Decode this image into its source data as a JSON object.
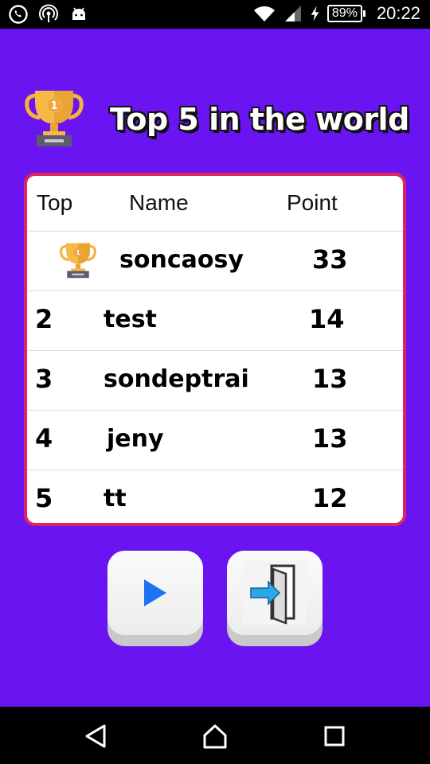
{
  "status_bar": {
    "battery": "89%",
    "time": "20:22",
    "icons": [
      "whatsapp-icon",
      "hotspot-icon",
      "android-icon",
      "wifi-icon",
      "signal-icon",
      "charging-icon"
    ]
  },
  "header": {
    "title": "Top 5 in the world",
    "trophy_icon": "trophy-icon"
  },
  "leaderboard": {
    "columns": {
      "rank": "Top",
      "name": "Name",
      "point": "Point"
    },
    "rows": [
      {
        "rank": "",
        "rank_icon": "trophy-icon",
        "name": "soncaosy",
        "point": "33"
      },
      {
        "rank": "2",
        "name": "test",
        "point": "14"
      },
      {
        "rank": "3",
        "name": "sondeptrai",
        "point": "13"
      },
      {
        "rank": "4",
        "name": "jeny",
        "point": "13"
      },
      {
        "rank": "5",
        "name": "tt",
        "point": "12"
      }
    ]
  },
  "buttons": {
    "play_icon": "play-icon",
    "exit_icon": "exit-door-icon"
  },
  "nav_bar": {
    "icons": [
      "back-icon",
      "home-icon",
      "recents-icon"
    ]
  },
  "colors": {
    "background": "#6a14f2",
    "board_border": "#e0245e",
    "play_blue": "#1e74f0"
  }
}
